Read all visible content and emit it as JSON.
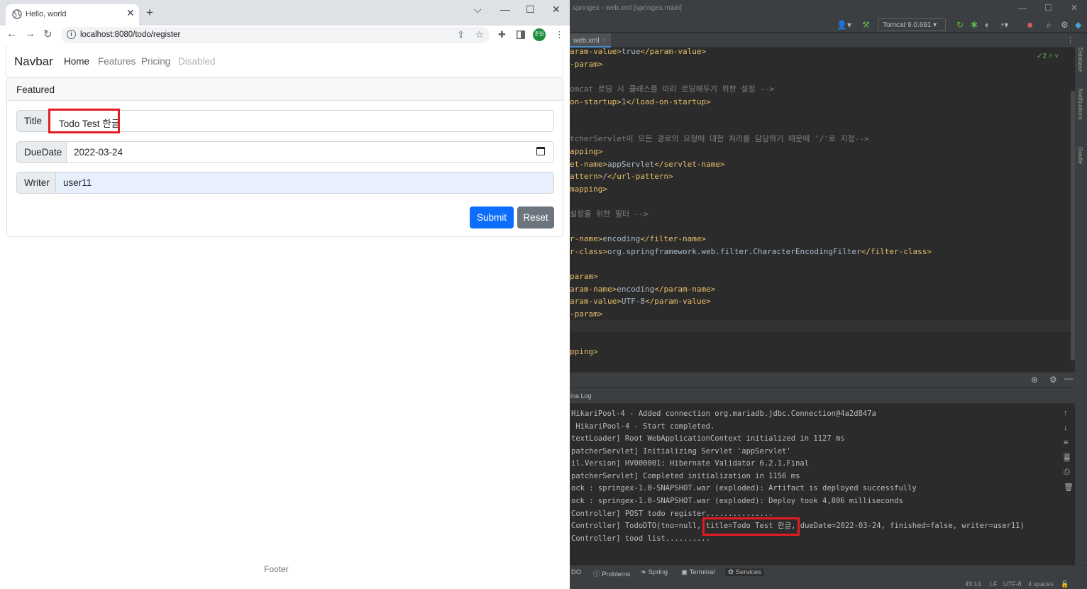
{
  "browser": {
    "tab_title": "Hello, world",
    "tab_close": "✕",
    "new_tab": "+",
    "window_controls": {
      "dropdown": "⌵",
      "minimize": "—",
      "maximize": "☐",
      "close": "✕"
    },
    "url": "localhost:8080/todo/register",
    "profile_initials": "준원",
    "icons": [
      "back-arrow-icon",
      "forward-arrow-icon",
      "reload-icon",
      "info-icon",
      "share-icon",
      "star-icon",
      "extensions-icon",
      "sidebar-icon",
      "menu-icon"
    ]
  },
  "page": {
    "navbar": {
      "brand": "Navbar",
      "links": [
        "Home",
        "Features",
        "Pricing",
        "Disabled"
      ]
    },
    "card_header": "Featured",
    "fields": {
      "title_label": "Title",
      "title_value": "Todo Test 한글",
      "duedate_label": "DueDate",
      "duedate_value": "2022-03-24",
      "writer_label": "Writer",
      "writer_value": "user11"
    },
    "submit_label": "Submit",
    "reset_label": "Reset",
    "footer": "Footer",
    "colors": {
      "primary": "#0d6efd",
      "secondary": "#6c757d",
      "highlight": "#e31c23"
    }
  },
  "ide": {
    "window_title": "springex - web.xml [springex.main]",
    "run_config": "Tomcat 9.0.691",
    "file_tab": "web.xml",
    "inspection_count": "2",
    "code_lines": [
      {
        "tag": "aram-value>",
        "text": "true",
        "tag2": "</param-value>"
      },
      {
        "tag": "-param>"
      },
      {
        "comment": "omcat 로딩 시 클래스를 미리 로딩해두기 위한 설정 -->"
      },
      {
        "tag": "on-startup>",
        "text": "1",
        "tag2": "</load-on-startup>"
      },
      {
        "comment": "tcherServlet이 모든 경로의 요청에 대한 처리를 담당하기 때문에 '/'로 지정-->"
      },
      {
        "tag": "apping>"
      },
      {
        "tag": "et-name>",
        "text": "appServlet",
        "tag2": "</servlet-name>"
      },
      {
        "tag": "attern>",
        "text": "/",
        "tag2": "</url-pattern>"
      },
      {
        "tag": "mapping>"
      },
      {
        "comment": "설정을 위한 필터 -->"
      },
      {
        "tag": "r-name>",
        "text": "encoding",
        "tag2": "</filter-name>"
      },
      {
        "tag": "r-class>",
        "text": "org.springframework.web.filter.CharacterEncodingFilter",
        "tag2": "</filter-class>"
      },
      {
        "tag": "param>"
      },
      {
        "tag": "aram-name>",
        "text": "encoding",
        "tag2": "</param-name>"
      },
      {
        "tag": "aram-value>",
        "text": "UTF-8",
        "tag2": "</param-value>"
      },
      {
        "tag": "-param>"
      },
      {
        "tag": "pping>"
      }
    ],
    "run_tab": "ina Log",
    "console_lines": [
      "HikariPool-4 - Added connection org.mariadb.jdbc.Connection@4a2d847a",
      " HikariPool-4 - Start completed.",
      "textLoader] Root WebApplicationContext initialized in 1127 ms",
      "patcherServlet] Initializing Servlet 'appServlet'",
      "il.Version] HV000001: Hibernate Validator 6.2.1.Final",
      "patcherServlet] Completed initialization in 1156 ms",
      "ock : springex-1.0-SNAPSHOT.war (exploded): Artifact is deployed successfully",
      "ock : springex-1.0-SNAPSHOT.war (exploded): Deploy took 4,806 milliseconds",
      "Controller] POST todo register...............",
      "Controller] TodoDTO(tno=null, title=Todo Test 한글, dueDate=2022-03-24, finished=false, writer=user11)",
      "Controller] tood list.........."
    ],
    "bottom_tabs": [
      "DO",
      "Problems",
      "Spring",
      "Terminal",
      "Services"
    ],
    "status": {
      "position": "49:14",
      "line_sep": "LF",
      "encoding": "UTF-8",
      "indent": "4 spaces"
    },
    "side_labels": [
      "Database",
      "Notifications",
      "Gradle"
    ]
  }
}
